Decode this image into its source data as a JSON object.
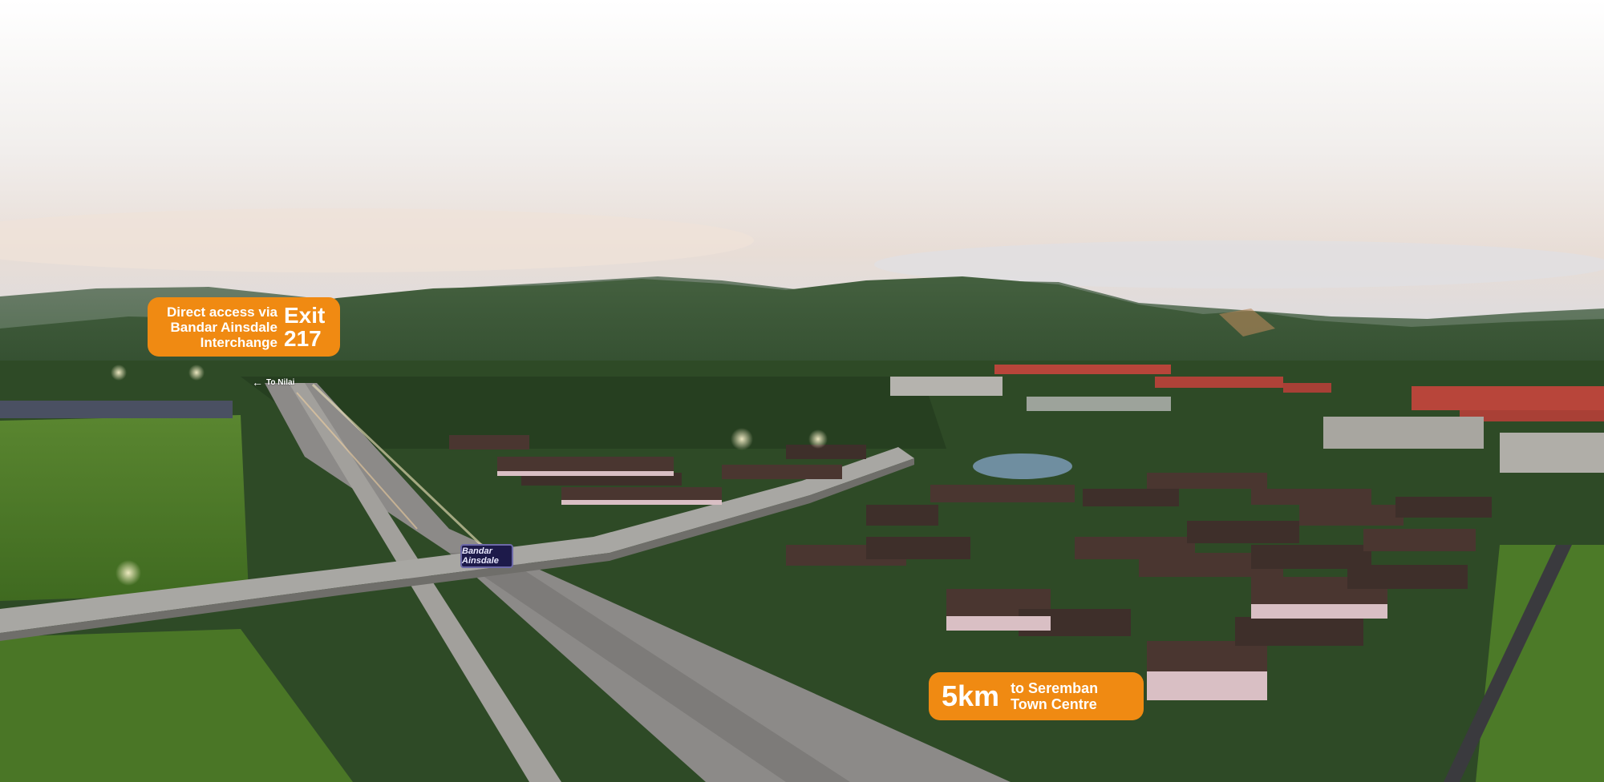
{
  "colors": {
    "callout_orange": "#f08a12",
    "sky_top": "#ffffff",
    "sky_horizon": "#e9e1dd",
    "mountains": "#3d5a3b",
    "field_green": "#4f7a2a",
    "highway": "#8c8a88",
    "roof_brown": "#4a3630",
    "house_pink": "#d9bfc4",
    "red_roofs": "#b8453a",
    "lake": "#6f8ea0"
  },
  "callouts": {
    "exit": {
      "description": "Direct access via\nBandar Ainsdale\nInterchange",
      "exit_label": "Exit\n217"
    },
    "distance": {
      "value": "5km",
      "description": "to Seremban\nTown Centre"
    }
  },
  "road_sign": {
    "arrow_icon": "arrow-left-icon",
    "text": "To Nilai"
  },
  "bridge_sign": {
    "text": "Bandar Ainsdale"
  }
}
